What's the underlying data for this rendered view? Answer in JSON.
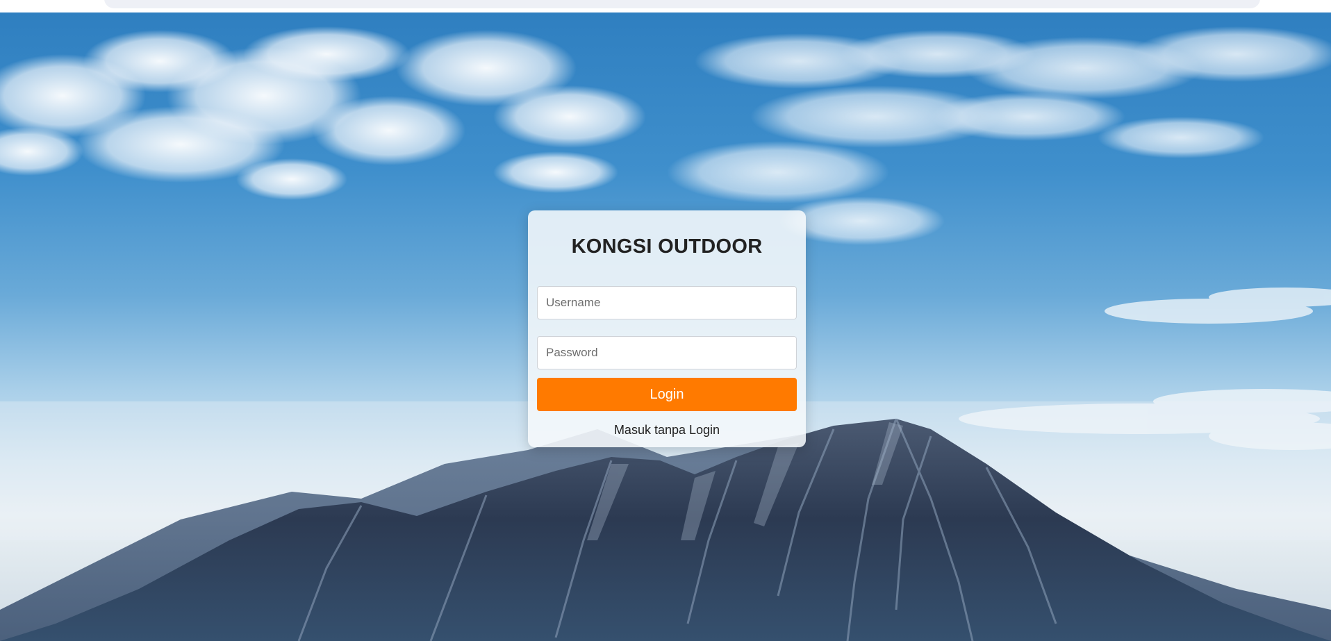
{
  "app": {
    "title": "KONGSI OUTDOOR"
  },
  "login_form": {
    "username_placeholder": "Username",
    "username_value": "",
    "password_placeholder": "Password",
    "password_value": "",
    "login_label": "Login",
    "guest_link_label": "Masuk tanpa Login"
  },
  "background": {
    "description_icon": "mountain-sky-photo"
  },
  "colors": {
    "accent": "#ff7a00",
    "card_background": "#f5f8fb",
    "title_text": "#222222"
  }
}
